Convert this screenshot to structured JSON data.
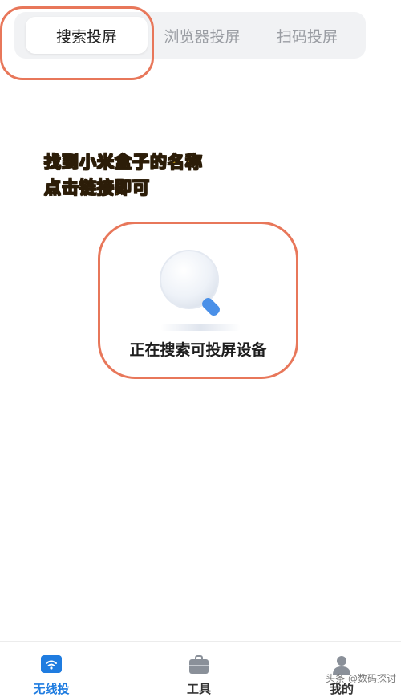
{
  "tabs": [
    {
      "label": "搜索投屏",
      "active": true
    },
    {
      "label": "浏览器投屏",
      "active": false
    },
    {
      "label": "扫码投屏",
      "active": false
    }
  ],
  "caption": {
    "line1": "找到小米盒子的名称",
    "line2": "点击链接即可"
  },
  "search": {
    "status": "正在搜索可投屏设备",
    "icon": "magnifier-icon"
  },
  "bottom_nav": [
    {
      "label": "无线投",
      "icon": "wifi-cast-icon",
      "active": true
    },
    {
      "label": "工具",
      "icon": "toolbox-icon",
      "active": false
    },
    {
      "label": "我的",
      "icon": "user-icon",
      "active": false
    }
  ],
  "watermark": "头条 @数码探讨",
  "colors": {
    "accent": "#1f7ce0",
    "highlight": "#e8775a",
    "caption": "#f6c21b"
  }
}
